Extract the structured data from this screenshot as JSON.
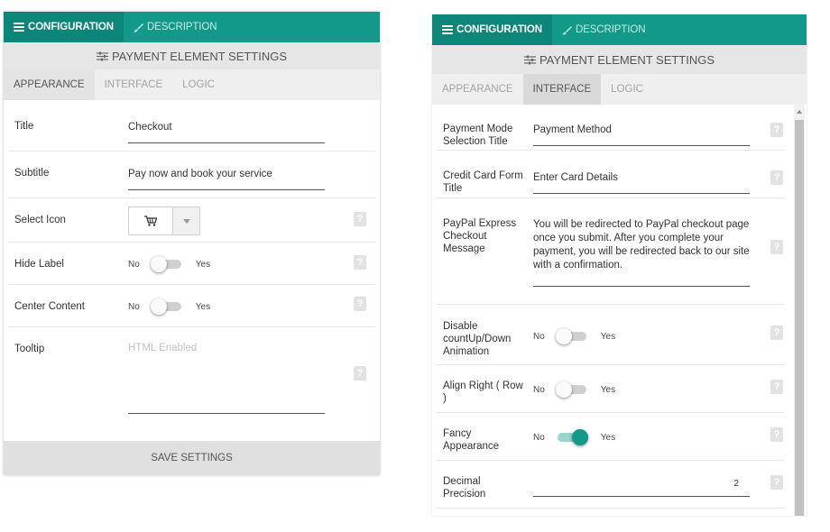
{
  "top_tabs": {
    "configuration": "CONFIGURATION",
    "description": "DESCRIPTION"
  },
  "settings_title": "PAYMENT ELEMENT SETTINGS",
  "sub_tabs": {
    "appearance": "APPEARANCE",
    "interface": "INTERFACE",
    "logic": "LOGIC"
  },
  "toggle": {
    "no": "No",
    "yes": "Yes"
  },
  "help_glyph": "?",
  "colors": {
    "accent": "#12998a",
    "accent_dark": "#0b8679"
  },
  "left_panel": {
    "active_sub_tab": "APPEARANCE",
    "title": {
      "label": "Title",
      "value": "Checkout"
    },
    "subtitle": {
      "label": "Subtitle",
      "value": "Pay now and book your service"
    },
    "select_icon": {
      "label": "Select Icon",
      "icon": "cart-icon"
    },
    "hide_label": {
      "label": "Hide Label",
      "on": false
    },
    "center_content": {
      "label": "Center Content",
      "on": false
    },
    "tooltip": {
      "label": "Tooltip",
      "placeholder": "HTML Enabled"
    },
    "save_label": "SAVE SETTINGS"
  },
  "right_panel": {
    "active_sub_tab": "INTERFACE",
    "payment_mode_title": {
      "label": "Payment Mode Selection Title",
      "value": "Payment Method"
    },
    "credit_card_title": {
      "label": "Credit Card Form Title",
      "value": "Enter Card Details"
    },
    "paypal_message": {
      "label": "PayPal Express Checkout Message",
      "value": "You will be redirected to PayPal checkout page once you submit. After you complete your payment, you will be redirected back to our site with a confirmation."
    },
    "disable_animation": {
      "label": "Disable countUp/Down Animation",
      "on": false
    },
    "align_right": {
      "label": "Align Right ( Row )",
      "on": false
    },
    "fancy_appearance": {
      "label": "Fancy Appearance",
      "on": true
    },
    "decimal_precision": {
      "label": "Decimal Precision",
      "value": "2"
    }
  }
}
